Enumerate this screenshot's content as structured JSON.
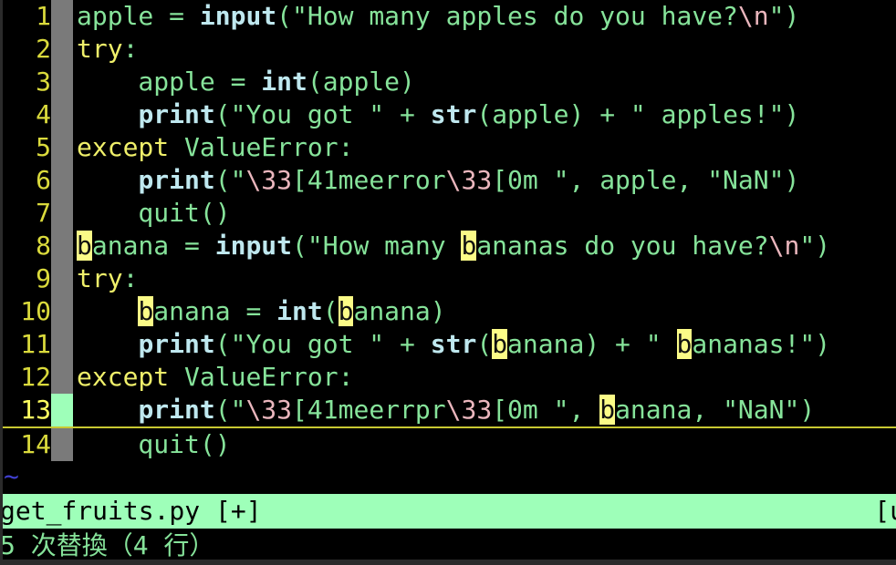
{
  "editor": {
    "name": "vim",
    "colors": {
      "background": "#000000",
      "line_number": "#dada3c",
      "string": "#86e39a",
      "builtin": "#bfe8ef",
      "keyword": "#f0f06a",
      "escape": "#eab6bd",
      "search_highlight_bg": "#fbfb87",
      "signcolumn": "#7a7a7a",
      "cursor": "#9effb9",
      "statusline_bg": "#9effb9",
      "statusline_fg": "#000000",
      "tilde": "#4040d0",
      "message": "#86e39a"
    },
    "tilde_marker": "~"
  },
  "lines": [
    {
      "number": "1",
      "cursor": false,
      "tokens": [
        {
          "t": "apple",
          "c": "ident"
        },
        {
          "t": " = ",
          "c": "op"
        },
        {
          "t": "input",
          "c": "builtin"
        },
        {
          "t": "(",
          "c": "paren"
        },
        {
          "t": "\"How many apples do you have?",
          "c": "str"
        },
        {
          "t": "\\n",
          "c": "esc"
        },
        {
          "t": "\"",
          "c": "str"
        },
        {
          "t": ")",
          "c": "paren"
        }
      ]
    },
    {
      "number": "2",
      "cursor": false,
      "tokens": [
        {
          "t": "try",
          "c": "keyword"
        },
        {
          "t": ":",
          "c": "op"
        }
      ]
    },
    {
      "number": "3",
      "cursor": false,
      "tokens": [
        {
          "t": "    apple",
          "c": "ident"
        },
        {
          "t": " = ",
          "c": "op"
        },
        {
          "t": "int",
          "c": "builtin"
        },
        {
          "t": "(",
          "c": "paren"
        },
        {
          "t": "apple",
          "c": "ident"
        },
        {
          "t": ")",
          "c": "paren"
        }
      ]
    },
    {
      "number": "4",
      "cursor": false,
      "tokens": [
        {
          "t": "    ",
          "c": "op"
        },
        {
          "t": "print",
          "c": "builtin"
        },
        {
          "t": "(",
          "c": "paren"
        },
        {
          "t": "\"You got \"",
          "c": "str"
        },
        {
          "t": " + ",
          "c": "op"
        },
        {
          "t": "str",
          "c": "builtin"
        },
        {
          "t": "(",
          "c": "paren"
        },
        {
          "t": "apple",
          "c": "ident"
        },
        {
          "t": ")",
          "c": "paren"
        },
        {
          "t": " + ",
          "c": "op"
        },
        {
          "t": "\" apples!\"",
          "c": "str"
        },
        {
          "t": ")",
          "c": "paren"
        }
      ]
    },
    {
      "number": "5",
      "cursor": false,
      "tokens": [
        {
          "t": "except",
          "c": "keyword"
        },
        {
          "t": " ",
          "c": "op"
        },
        {
          "t": "ValueError",
          "c": "exc"
        },
        {
          "t": ":",
          "c": "op"
        }
      ]
    },
    {
      "number": "6",
      "cursor": false,
      "tokens": [
        {
          "t": "    ",
          "c": "op"
        },
        {
          "t": "print",
          "c": "builtin"
        },
        {
          "t": "(",
          "c": "paren"
        },
        {
          "t": "\"",
          "c": "str"
        },
        {
          "t": "\\33",
          "c": "esc"
        },
        {
          "t": "[41meerror",
          "c": "str"
        },
        {
          "t": "\\33",
          "c": "esc"
        },
        {
          "t": "[0m \"",
          "c": "str"
        },
        {
          "t": ", apple, ",
          "c": "op"
        },
        {
          "t": "\"NaN\"",
          "c": "str"
        },
        {
          "t": ")",
          "c": "paren"
        }
      ]
    },
    {
      "number": "7",
      "cursor": false,
      "tokens": [
        {
          "t": "    quit",
          "c": "ident"
        },
        {
          "t": "()",
          "c": "paren"
        }
      ]
    },
    {
      "number": "8",
      "cursor": false,
      "tokens": [
        {
          "t": "b",
          "c": "ident",
          "hl": true
        },
        {
          "t": "anana",
          "c": "ident"
        },
        {
          "t": " = ",
          "c": "op"
        },
        {
          "t": "input",
          "c": "builtin"
        },
        {
          "t": "(",
          "c": "paren"
        },
        {
          "t": "\"How many ",
          "c": "str"
        },
        {
          "t": "b",
          "c": "str",
          "hl": true
        },
        {
          "t": "ananas do you have?",
          "c": "str"
        },
        {
          "t": "\\n",
          "c": "esc"
        },
        {
          "t": "\"",
          "c": "str"
        },
        {
          "t": ")",
          "c": "paren"
        }
      ]
    },
    {
      "number": "9",
      "cursor": false,
      "tokens": [
        {
          "t": "try",
          "c": "keyword"
        },
        {
          "t": ":",
          "c": "op"
        }
      ]
    },
    {
      "number": "10",
      "cursor": false,
      "tokens": [
        {
          "t": "    ",
          "c": "op"
        },
        {
          "t": "b",
          "c": "ident",
          "hl": true
        },
        {
          "t": "anana",
          "c": "ident"
        },
        {
          "t": " = ",
          "c": "op"
        },
        {
          "t": "int",
          "c": "builtin"
        },
        {
          "t": "(",
          "c": "paren"
        },
        {
          "t": "b",
          "c": "ident",
          "hl": true
        },
        {
          "t": "anana",
          "c": "ident"
        },
        {
          "t": ")",
          "c": "paren"
        }
      ]
    },
    {
      "number": "11",
      "cursor": false,
      "tokens": [
        {
          "t": "    ",
          "c": "op"
        },
        {
          "t": "print",
          "c": "builtin"
        },
        {
          "t": "(",
          "c": "paren"
        },
        {
          "t": "\"You got \"",
          "c": "str"
        },
        {
          "t": " + ",
          "c": "op"
        },
        {
          "t": "str",
          "c": "builtin"
        },
        {
          "t": "(",
          "c": "paren"
        },
        {
          "t": "b",
          "c": "ident",
          "hl": true
        },
        {
          "t": "anana",
          "c": "ident"
        },
        {
          "t": ")",
          "c": "paren"
        },
        {
          "t": " + ",
          "c": "op"
        },
        {
          "t": "\" ",
          "c": "str"
        },
        {
          "t": "b",
          "c": "str",
          "hl": true
        },
        {
          "t": "ananas!\"",
          "c": "str"
        },
        {
          "t": ")",
          "c": "paren"
        }
      ]
    },
    {
      "number": "12",
      "cursor": false,
      "tokens": [
        {
          "t": "except",
          "c": "keyword"
        },
        {
          "t": " ",
          "c": "op"
        },
        {
          "t": "ValueError",
          "c": "exc"
        },
        {
          "t": ":",
          "c": "op"
        }
      ]
    },
    {
      "number": "13",
      "cursor": true,
      "tokens": [
        {
          "t": "    ",
          "c": "op"
        },
        {
          "t": "print",
          "c": "builtin"
        },
        {
          "t": "(",
          "c": "paren"
        },
        {
          "t": "\"",
          "c": "str"
        },
        {
          "t": "\\33",
          "c": "esc"
        },
        {
          "t": "[41meerrpr",
          "c": "str"
        },
        {
          "t": "\\33",
          "c": "esc"
        },
        {
          "t": "[0m \"",
          "c": "str"
        },
        {
          "t": ", ",
          "c": "op"
        },
        {
          "t": "b",
          "c": "ident",
          "hl": true
        },
        {
          "t": "anana",
          "c": "ident"
        },
        {
          "t": ", ",
          "c": "op"
        },
        {
          "t": "\"NaN\"",
          "c": "str"
        },
        {
          "t": ")",
          "c": "paren"
        }
      ]
    },
    {
      "number": "14",
      "cursor": false,
      "tokens": [
        {
          "t": "    quit",
          "c": "ident"
        },
        {
          "t": "()",
          "c": "paren"
        }
      ]
    }
  ],
  "statusline": {
    "filename": "get_fruits.py [+]",
    "right": "[u"
  },
  "messageline": {
    "text": "5 次替換（4 行）"
  }
}
